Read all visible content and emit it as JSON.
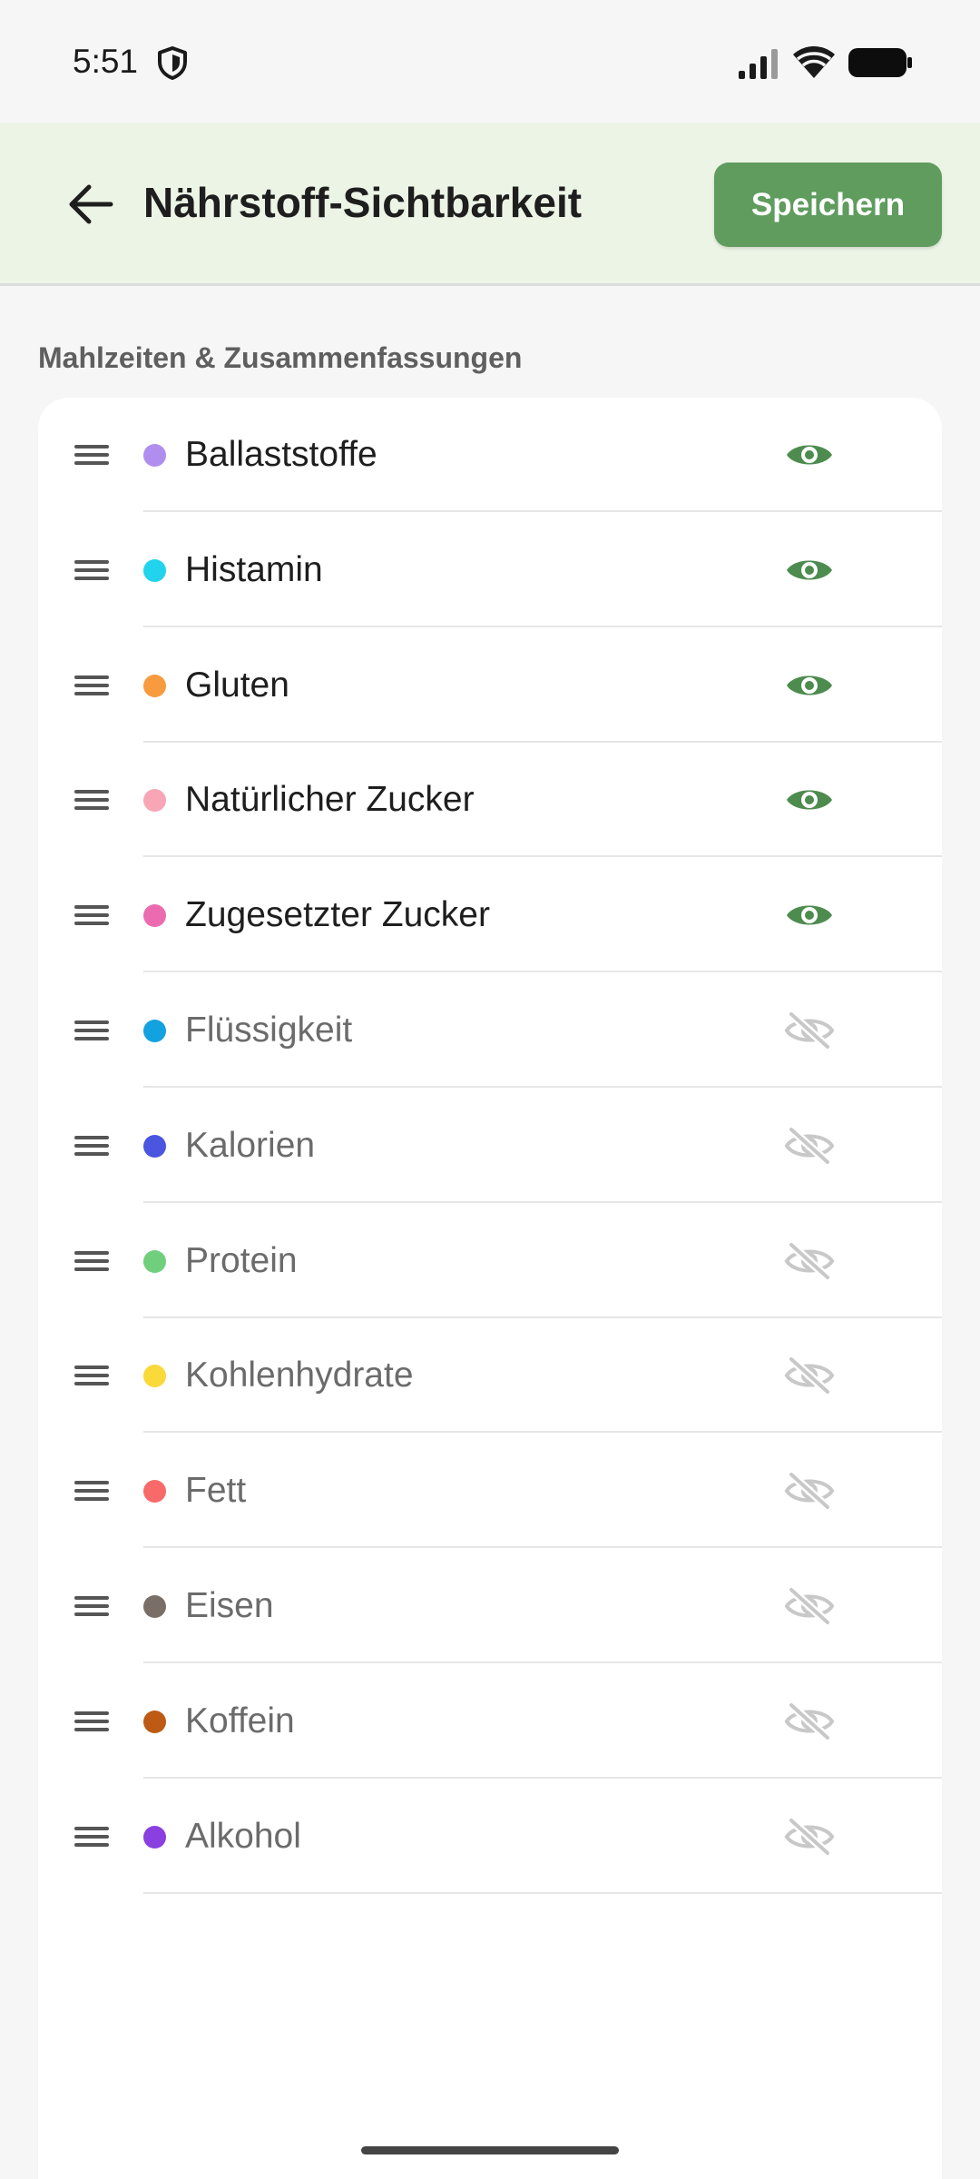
{
  "status_bar": {
    "time": "5:51",
    "icons": [
      "shield-icon",
      "signal-icon",
      "wifi-icon",
      "battery-icon"
    ]
  },
  "header": {
    "title": "Nährstoff-Sichtbarkeit",
    "save_label": "Speichern",
    "back_icon": "arrow-left-icon"
  },
  "colors": {
    "accent": "#5f9c5e",
    "header_bg": "#ecf4e6",
    "visible_eye": "#4d8c4e",
    "hidden_eye": "#c8c8c8"
  },
  "section": {
    "title": "Mahlzeiten & Zusammenfassungen"
  },
  "nutrients": [
    {
      "label": "Ballaststoffe",
      "color": "#b08ef0",
      "visible": true
    },
    {
      "label": "Histamin",
      "color": "#22d3ee",
      "visible": true
    },
    {
      "label": "Gluten",
      "color": "#f89a3e",
      "visible": true
    },
    {
      "label": "Natürlicher Zucker",
      "color": "#f8a5b5",
      "visible": true
    },
    {
      "label": "Zugesetzter Zucker",
      "color": "#ec6bb0",
      "visible": true
    },
    {
      "label": "Flüssigkeit",
      "color": "#12a2e0",
      "visible": false
    },
    {
      "label": "Kalorien",
      "color": "#4a55e0",
      "visible": false
    },
    {
      "label": "Protein",
      "color": "#6fcf7d",
      "visible": false
    },
    {
      "label": "Kohlenhydrate",
      "color": "#fad93a",
      "visible": false
    },
    {
      "label": "Fett",
      "color": "#f86a6a",
      "visible": false
    },
    {
      "label": "Eisen",
      "color": "#7a6f68",
      "visible": false
    },
    {
      "label": "Koffein",
      "color": "#bd5a14",
      "visible": false
    },
    {
      "label": "Alkohol",
      "color": "#8a3fe0",
      "visible": false
    }
  ]
}
